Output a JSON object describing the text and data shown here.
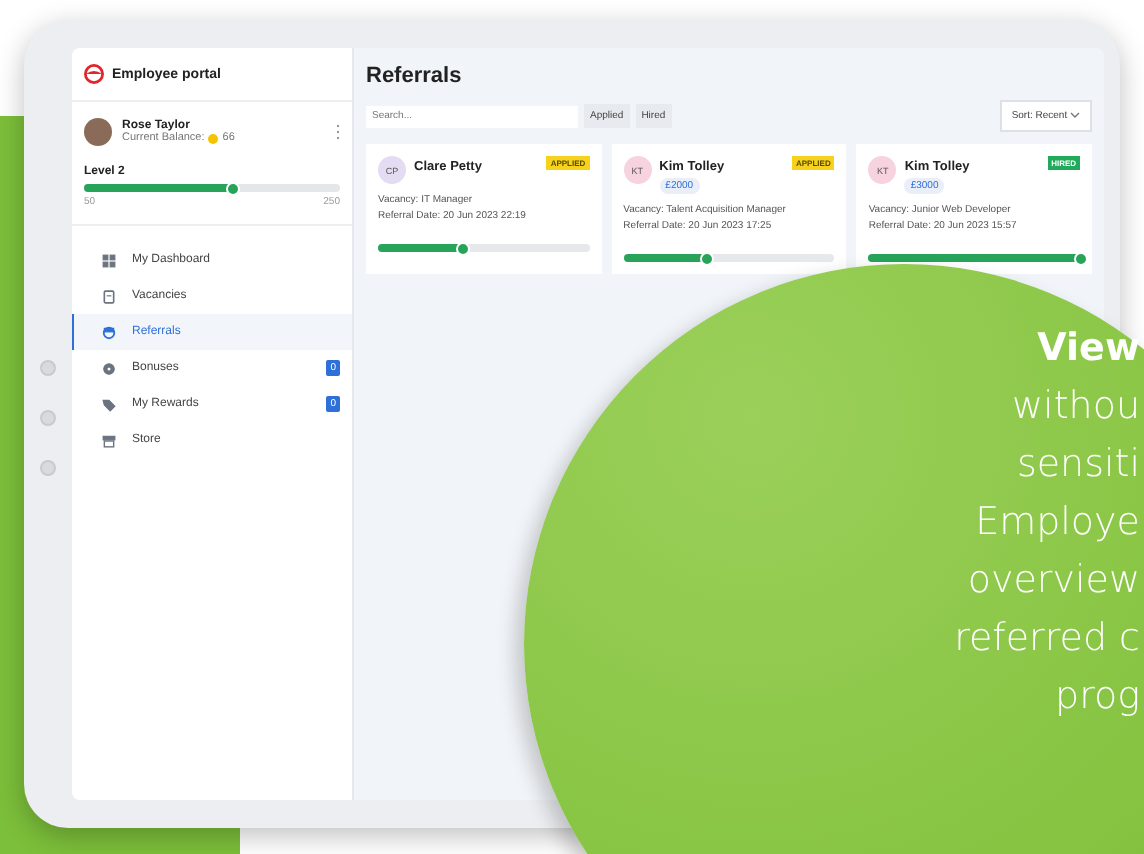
{
  "sidebar": {
    "app_title": "Employee portal",
    "user": {
      "name": "Rose Taylor",
      "balance_label": "Current Balance:",
      "balance": "66"
    },
    "level": {
      "label": "Level 2",
      "level": 0.58,
      "min": "50",
      "max": "250"
    },
    "items": [
      {
        "label": "My Dashboard",
        "kind": "grid",
        "selected": false
      },
      {
        "label": "Vacancies",
        "kind": "clipboard",
        "selected": false
      },
      {
        "label": "Referrals",
        "kind": "referral",
        "selected": true
      },
      {
        "label": "Bonuses",
        "kind": "gear",
        "selected": false,
        "badge": "0"
      },
      {
        "label": "My Rewards",
        "kind": "tag",
        "selected": false,
        "badge": "0"
      },
      {
        "label": "Store",
        "kind": "store",
        "selected": false
      }
    ]
  },
  "main": {
    "title": "Referrals",
    "search": {
      "placeholder": "Search..."
    },
    "filters": [
      "Applied",
      "Hired"
    ],
    "sort": "Sort: Recent",
    "cards": [
      {
        "initials": "CP",
        "color": "#e4dcf3",
        "name": "Clare Petty",
        "status": "APPLIED",
        "kind": "applied",
        "vacancy": "Vacancy: IT Manager",
        "date": "Referral Date: 20 Jun 2023 22:19",
        "level": 0.4
      },
      {
        "initials": "KT",
        "color": "#f7d3df",
        "name": "Kim Tolley",
        "bonus": "£2000",
        "status": "APPLIED",
        "kind": "applied",
        "vacancy": "Vacancy: Talent Acquisition Manager",
        "date": "Referral Date: 20 Jun 2023 17:25",
        "level": 0.4
      },
      {
        "initials": "KT",
        "color": "#f7d3df",
        "name": "Kim Tolley",
        "bonus": "£3000",
        "status": "HIRED",
        "kind": "hired",
        "vacancy": "Vacancy: Junior Web Developer",
        "date": "Referral Date: 20 Jun 2023 15:57",
        "level": 1.0
      }
    ]
  },
  "promo": {
    "lines": [
      "View",
      "withou",
      "sensiti",
      "Employe",
      "overview",
      "referred c",
      "prog"
    ]
  }
}
